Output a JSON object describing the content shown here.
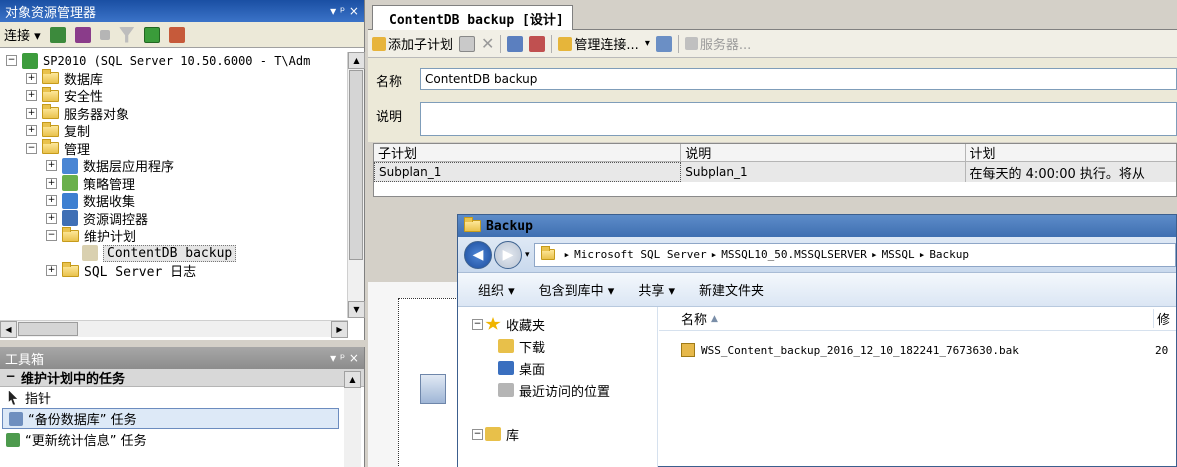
{
  "object_explorer": {
    "title": "对象资源管理器",
    "pin_controls": "▾ ᵖ ×",
    "connect_label": "连接 ▾",
    "tree": [
      {
        "label": "SP2010  (SQL Server 10.50.6000 - T\\Adm",
        "level": 0,
        "expander": "−",
        "icon": "server-icon"
      },
      {
        "label": "数据库",
        "level": 1,
        "expander": "+",
        "icon": "folder-icon"
      },
      {
        "label": "安全性",
        "level": 1,
        "expander": "+",
        "icon": "folder-icon"
      },
      {
        "label": "服务器对象",
        "level": 1,
        "expander": "+",
        "icon": "folder-icon"
      },
      {
        "label": "复制",
        "level": 1,
        "expander": "+",
        "icon": "folder-icon"
      },
      {
        "label": "管理",
        "level": 1,
        "expander": "−",
        "icon": "folder-icon"
      },
      {
        "label": "数据层应用程序",
        "level": 2,
        "expander": "+",
        "icon": "data-tier-app-icon"
      },
      {
        "label": "策略管理",
        "level": 2,
        "expander": "+",
        "icon": "policy-icon"
      },
      {
        "label": "数据收集",
        "level": 2,
        "expander": "+",
        "icon": "data-collection-icon"
      },
      {
        "label": "资源调控器",
        "level": 2,
        "expander": "+",
        "icon": "resource-governor-icon"
      },
      {
        "label": "维护计划",
        "level": 2,
        "expander": "−",
        "icon": "folder-icon"
      },
      {
        "label": "ContentDB backup",
        "level": 3,
        "expander": "",
        "icon": "maintenance-plan-icon",
        "selected": true
      },
      {
        "label": "SQL Server 日志",
        "level": 2,
        "expander": "+",
        "icon": "folder-icon"
      }
    ]
  },
  "toolbox": {
    "title": "工具箱",
    "pin_controls": "▾ ᵖ ×",
    "section": "维护计划中的任务",
    "section_expander": "−",
    "items": [
      {
        "label": "指针",
        "icon": "pointer-icon"
      },
      {
        "label": "“备份数据库” 任务",
        "icon": "backup-task-icon",
        "highlighted": true
      },
      {
        "label": "“更新统计信息” 任务",
        "icon": "statistics-task-icon"
      }
    ]
  },
  "document": {
    "tab_label": "ContentDB backup [设计]",
    "toolbar": {
      "add_subplan": "添加子计划",
      "manage_connections": "管理连接...",
      "dropdown": "▾",
      "servers": "服务器..."
    },
    "name_label": "名称",
    "name_value": "ContentDB backup",
    "description_label": "说明",
    "description_value": "",
    "grid": {
      "headers": [
        "子计划",
        "说明",
        "计划"
      ],
      "rows": [
        [
          "Subplan_1",
          "Subplan_1",
          "在每天的 4:00:00 执行。将从"
        ]
      ]
    }
  },
  "explorer": {
    "title": "Backup",
    "address": [
      "Microsoft SQL Server",
      "MSSQL10_50.MSSQLSERVER",
      "MSSQL",
      "Backup"
    ],
    "address_sep": "▸",
    "commands": [
      "组织 ▾",
      "包含到库中 ▾",
      "共享 ▾",
      "新建文件夹"
    ],
    "nav": [
      {
        "label": "收藏夹",
        "expander": "−",
        "icon": "star-icon"
      },
      {
        "label": "下载",
        "icon": "download-folder-icon"
      },
      {
        "label": "桌面",
        "icon": "desktop-icon"
      },
      {
        "label": "最近访问的位置",
        "icon": "recent-places-icon"
      },
      {
        "label": "库",
        "expander": "−",
        "icon": "library-icon"
      }
    ],
    "columns": {
      "name": "名称",
      "sort_indicator": "▲",
      "modified": "修"
    },
    "files": [
      {
        "name": "WSS_Content_backup_2016_12_10_182241_7673630.bak",
        "modified": "20"
      }
    ]
  }
}
